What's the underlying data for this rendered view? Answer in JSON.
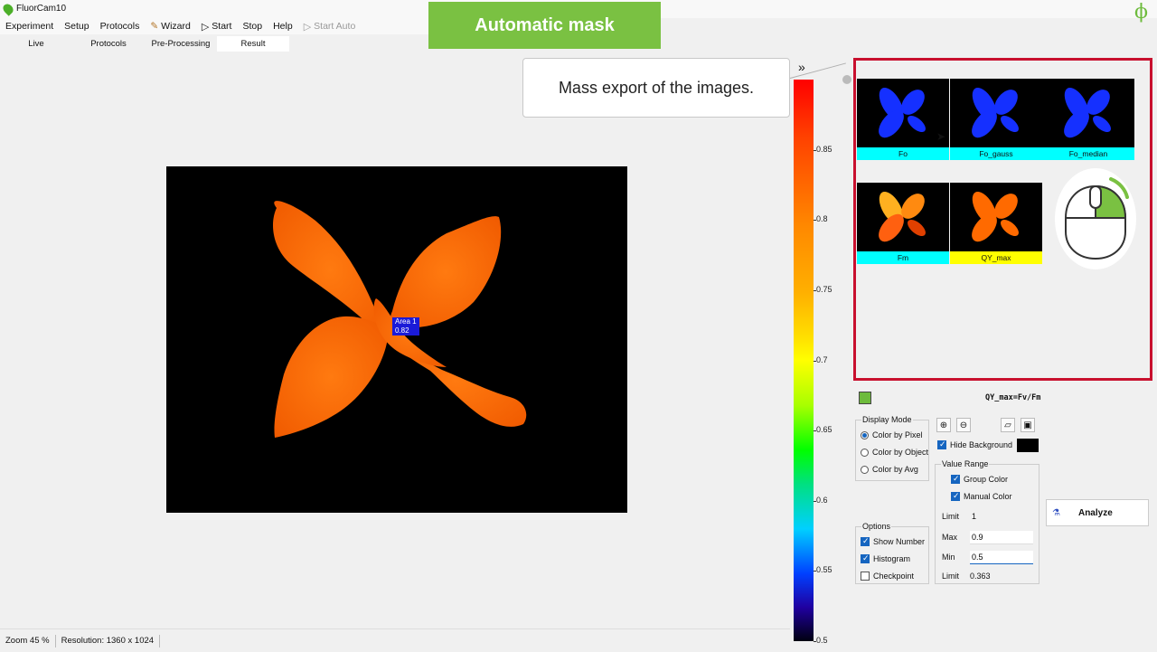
{
  "window": {
    "title": "FluorCam10"
  },
  "banner": {
    "text": "Automatic mask"
  },
  "menu": {
    "items": [
      "Experiment",
      "Setup",
      "Protocols"
    ],
    "wizard": "Wizard",
    "start": "Start",
    "stop": "Stop",
    "help": "Help",
    "start_auto": "Start Auto"
  },
  "tabs": [
    "Live",
    "Protocols",
    "Pre-Processing",
    "Result"
  ],
  "callout": {
    "text": "Mass export of the images."
  },
  "image": {
    "area_name": "Area 1",
    "area_value": "0.82"
  },
  "statusbar": {
    "zoom": "Zoom 45 %",
    "resolution": "Resolution: 1360 x 1024"
  },
  "colorbar": {
    "ticks": [
      "0.85",
      "0.8",
      "0.75",
      "0.7",
      "0.65",
      "0.6",
      "0.55",
      "0.5"
    ],
    "tick_values": [
      0.85,
      0.8,
      0.75,
      0.7,
      0.65,
      0.6,
      0.55,
      0.5
    ],
    "range": [
      0.5,
      0.9
    ]
  },
  "gallery": {
    "row1": [
      "Fo",
      "Fo_gauss",
      "Fo_median"
    ],
    "row2": [
      "Fm",
      "QY_max"
    ]
  },
  "formula": "QY_max=Fv/Fm",
  "display_mode": {
    "title": "Display Mode",
    "options": [
      "Color by Pixel",
      "Color by Object",
      "Color by Avg"
    ],
    "selected": "Color by Pixel"
  },
  "options": {
    "title": "Options",
    "items": [
      "Show Number",
      "Histogram",
      "Checkpoint"
    ],
    "checked": [
      true,
      true,
      false
    ]
  },
  "hide_background": "Hide Background",
  "value_range": {
    "title": "Value Range",
    "group_color": "Group Color",
    "manual_color": "Manual Color",
    "limit_label": "Limit",
    "limit_top": "1",
    "max_label": "Max",
    "max_value": "0.9",
    "min_label": "Min",
    "min_value": "0.5",
    "limit_bottom": "0.363"
  },
  "analyze": {
    "label": "Analyze"
  },
  "colors": {
    "banner": "#7ac142",
    "gallery_border": "#c8102e",
    "caption_cyan": "#00ffff",
    "caption_yellow": "#ffff00",
    "accent": "#1565c0"
  }
}
